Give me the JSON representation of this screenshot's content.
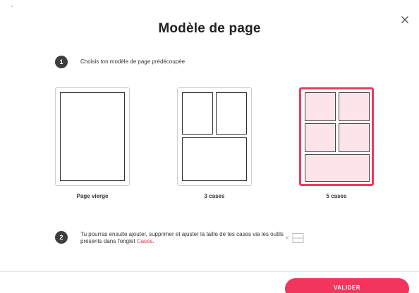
{
  "dialog": {
    "title": "Modèle de page",
    "close_icon": "close-icon"
  },
  "step1": {
    "number": "1",
    "text": "Choisis ton modèle de page prédécoupée"
  },
  "templates": [
    {
      "label": "Page vierge",
      "selected": false
    },
    {
      "label": "3 cases",
      "selected": false
    },
    {
      "label": "5 cases",
      "selected": true
    }
  ],
  "step2": {
    "number": "2",
    "text_before": "Tu pourras ensuite ajouter, supprimer et ajuster la taille de tes cases via les outils présents dans l'onglet ",
    "link": "Cases",
    "text_after": ".",
    "icon": "cases-tool-icon"
  },
  "footer": {
    "submit_label": "VALIDER"
  },
  "colors": {
    "accent": "#f2355d",
    "selected_border": "#ec3a5c",
    "selected_fill": "#fde4e8",
    "step_badge": "#3e3e3e"
  }
}
